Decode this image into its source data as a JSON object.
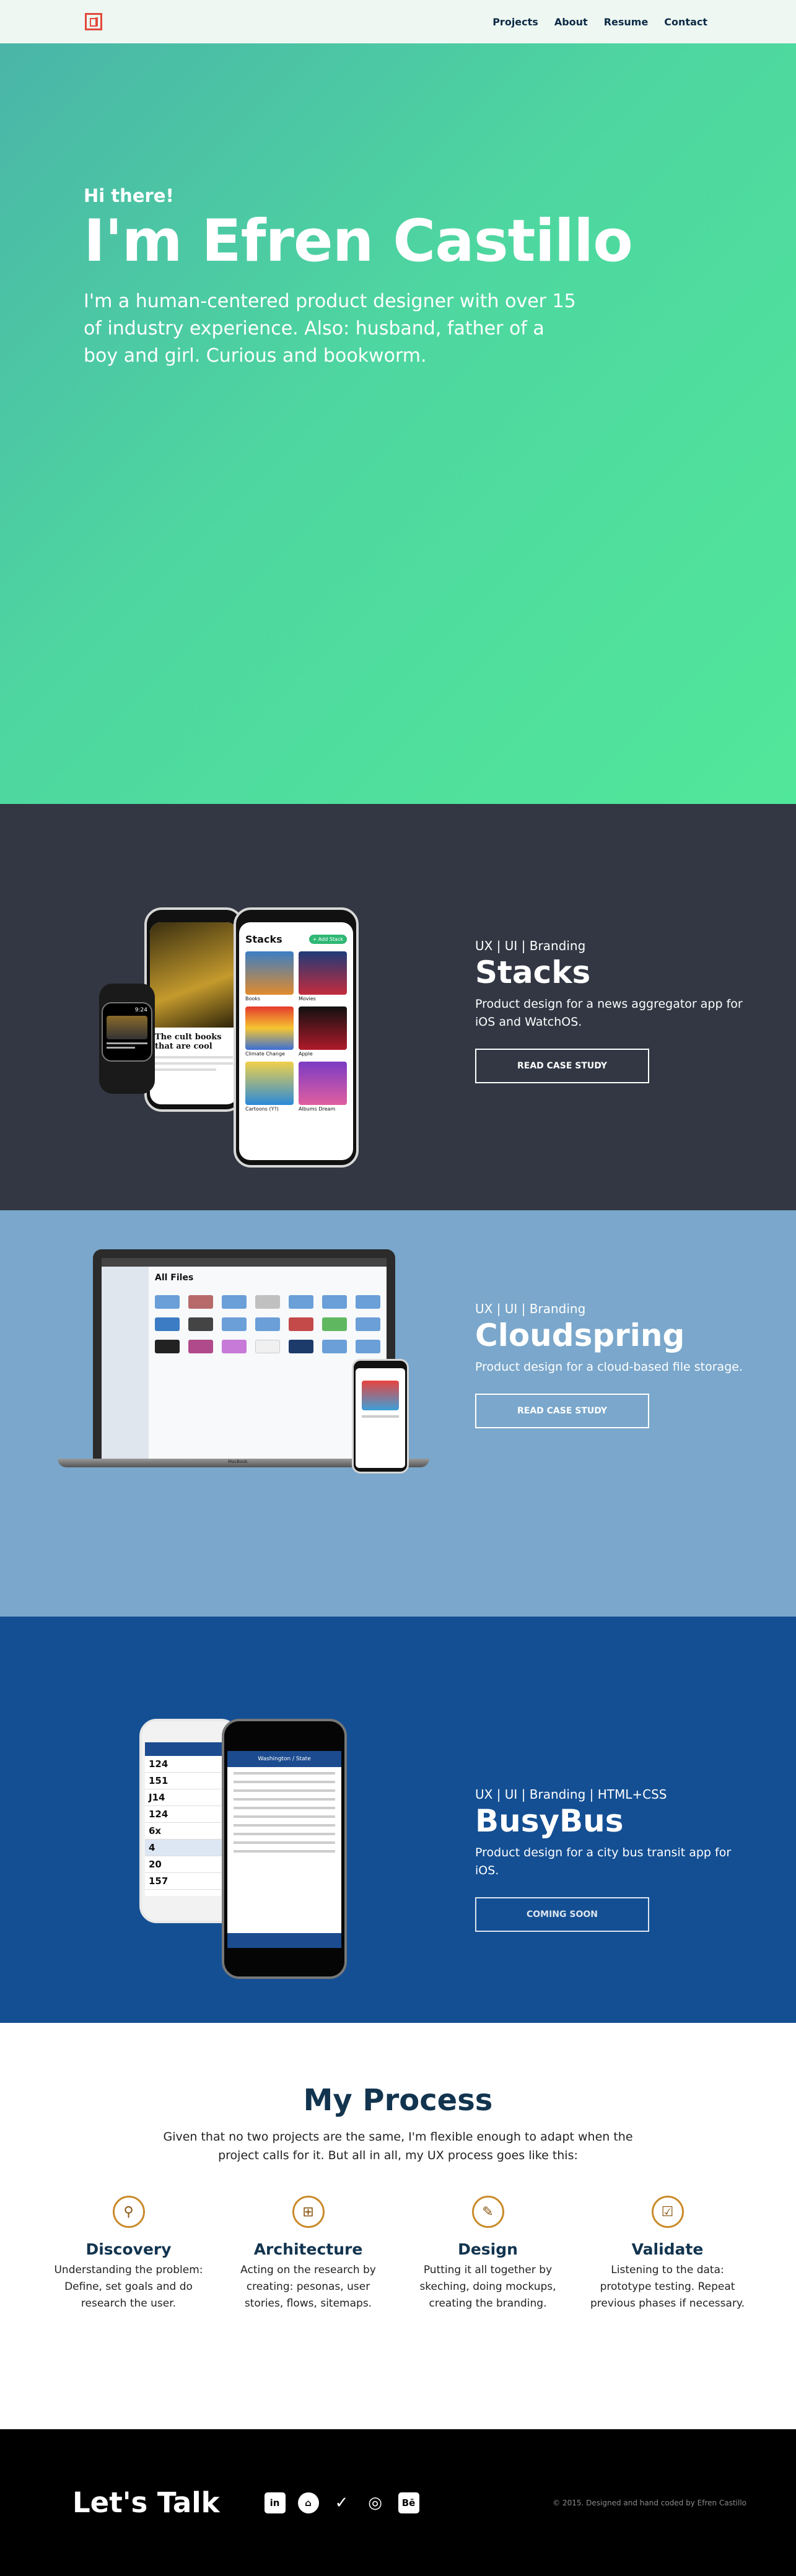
{
  "nav": {
    "links": [
      "Projects",
      "About",
      "Resume",
      "Contact"
    ]
  },
  "hero": {
    "greeting": "Hi there!",
    "name": "I'm Efren Castillo",
    "bio": "I'm a human-centered product designer with over 15 of industry experience. Also: husband, father of a boy and girl. Curious and bookworm."
  },
  "projects": [
    {
      "tags": "UX | UI | Branding",
      "title": "Stacks",
      "description": "Product design for a news aggregator app for iOS and WatchOS.",
      "button": "READ CASE STUDY",
      "mock": {
        "header": "Stacks",
        "pill": "+ Add Stack",
        "cats": [
          "Books",
          "Movies",
          "Climate Change",
          "Apple",
          "Cartoons (Y?)",
          "Albums Dream"
        ],
        "article": "The cult books that are cool",
        "watch_time": "9:24"
      }
    },
    {
      "tags": "UX | UI | Branding",
      "title": "Cloudspring",
      "description": "Product design for a cloud-based file storage.",
      "button": "READ CASE STUDY",
      "mock": {
        "header": "All Files",
        "label": "MacBook"
      }
    },
    {
      "tags": "UX | UI | Branding | HTML+CSS",
      "title": "BusyBus",
      "description": "Product design for a city bus transit app for iOS.",
      "button": "COMING SOON",
      "mock": {
        "header": "Washington / State",
        "routes": [
          "124",
          "151",
          "J14",
          "124",
          "6x",
          "4",
          "20",
          "157"
        ]
      }
    }
  ],
  "process": {
    "title": "My Process",
    "intro": "Given that no two projects are the same, I'm flexible enough to adapt when the project calls for it. But all in all, my UX process goes like this:",
    "steps": [
      {
        "icon": "telescope-icon",
        "title": "Discovery",
        "text": "Understanding the problem: Define, set goals and do research the user."
      },
      {
        "icon": "sitemap-icon",
        "title": "Architecture",
        "text": "Acting on the research by creating: pesonas, user stories, flows, sitemaps."
      },
      {
        "icon": "palette-icon",
        "title": "Design",
        "text": "Putting it all together by skeching, doing mockups, creating the branding."
      },
      {
        "icon": "checklist-icon",
        "title": "Validate",
        "text": "Listening to the data: prototype testing. Repeat previous phases if necessary."
      }
    ]
  },
  "footer": {
    "title": "Let's Talk",
    "socials": [
      "in",
      "⌂",
      "✓",
      "◎",
      "Bē"
    ],
    "copyright": "© 2015. Designed and hand coded by Efren Castillo"
  },
  "colors": {
    "accent": "#e3483b",
    "stacks_bg": "#323743",
    "cloud_bg": "#7aa7cb",
    "bus_bg": "#144f93",
    "process_icon": "#c98a2a"
  }
}
